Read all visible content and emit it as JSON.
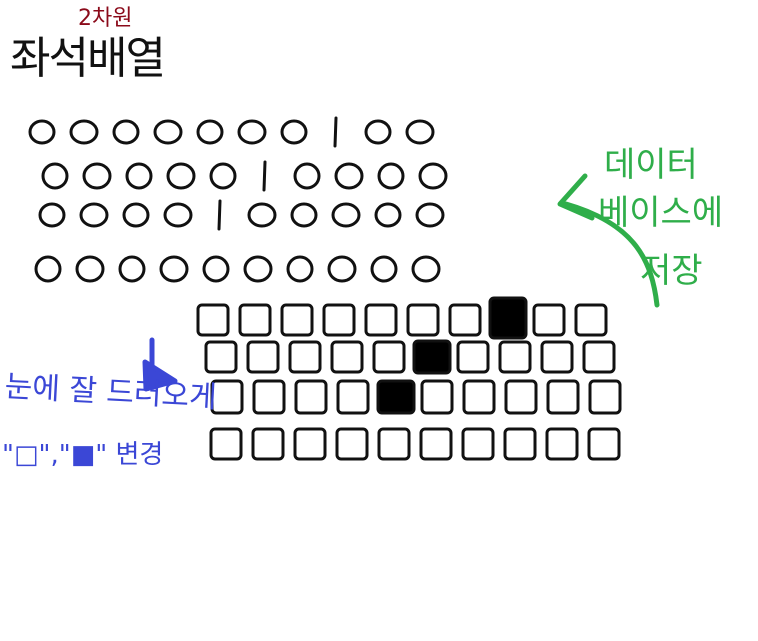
{
  "title": {
    "main": "좌석배열",
    "insert": "2차원"
  },
  "note_right": {
    "line1": "데이터",
    "line2": "베이스에",
    "line3": "저장"
  },
  "note_left": {
    "line1": "눈에 잘 드러오게",
    "line2": "\"□\",\"■\" 변경"
  },
  "colors": {
    "ink": "#111111",
    "title_insert": "#8b0a1a",
    "green_note": "#2fae4a",
    "blue_note": "#3b47d6",
    "fill": "#000000"
  },
  "grid_before": {
    "shape": "circle",
    "rows": [
      [
        "0",
        "0",
        "0",
        "0",
        "0",
        "0",
        "0",
        "1",
        "0",
        "0"
      ],
      [
        "0",
        "0",
        "0",
        "0",
        "0",
        "1",
        "0",
        "0",
        "0",
        "0"
      ],
      [
        "0",
        "0",
        "0",
        "0",
        "1",
        "0",
        "0",
        "0",
        "0",
        "0"
      ],
      [
        "0",
        "0",
        "0",
        "0",
        "0",
        "0",
        "0",
        "0",
        "0",
        "0"
      ]
    ]
  },
  "grid_after": {
    "shape": "square",
    "rows": [
      [
        0,
        0,
        0,
        0,
        0,
        0,
        0,
        1,
        0,
        0
      ],
      [
        0,
        0,
        0,
        0,
        0,
        1,
        0,
        0,
        0,
        0
      ],
      [
        0,
        0,
        0,
        0,
        1,
        0,
        0,
        0,
        0,
        0
      ],
      [
        0,
        0,
        0,
        0,
        0,
        0,
        0,
        0,
        0,
        0
      ]
    ]
  }
}
